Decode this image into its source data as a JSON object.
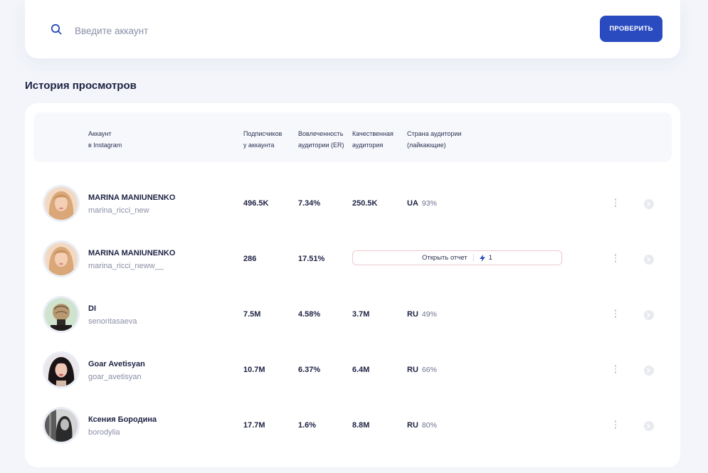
{
  "search": {
    "placeholder": "Введите аккаунт",
    "button_label": "ПРОВЕРИТЬ"
  },
  "history": {
    "title": "История просмотров",
    "columns": {
      "account": [
        "Аккаунт",
        "в Instagram"
      ],
      "followers": [
        "Подписчиков",
        "у аккаунта"
      ],
      "engagement": [
        "Вовлеченность",
        "аудитории (ER)"
      ],
      "quality": [
        "Качественная",
        "аудитория"
      ],
      "country": [
        "Страна аудитории",
        "(лайкающие)"
      ]
    },
    "report": {
      "label": "Открыть отчет",
      "count": "1"
    },
    "rows": [
      {
        "name": "MARINA MANIUNENKO",
        "handle": "marina_ricci_new",
        "followers": "496.5K",
        "er": "7.34%",
        "quality": "250.5K",
        "country": "UA",
        "country_pct": "93%",
        "avatar": "blonde-woman-avatar"
      },
      {
        "name": "MARINA MANIUNENKO",
        "handle": "marina_ricci_neww__",
        "followers": "286",
        "er": "17.51%",
        "quality": "",
        "country": "",
        "country_pct": "",
        "avatar": "blonde-woman-avatar",
        "report": true
      },
      {
        "name": "DI",
        "handle": "senoritasaeva",
        "followers": "7.5M",
        "er": "4.58%",
        "quality": "3.7M",
        "country": "RU",
        "country_pct": "49%",
        "avatar": "hair-bun-avatar"
      },
      {
        "name": "Goar Avetisyan",
        "handle": "goar_avetisyan",
        "followers": "10.7M",
        "er": "6.37%",
        "quality": "6.4M",
        "country": "RU",
        "country_pct": "66%",
        "avatar": "dark-hair-woman-avatar"
      },
      {
        "name": "Ксения Бородина",
        "handle": "borodylia",
        "followers": "17.7M",
        "er": "1.6%",
        "quality": "8.8M",
        "country": "RU",
        "country_pct": "80%",
        "avatar": "monochrome-avatar"
      }
    ]
  },
  "colors": {
    "accent": "#2a4bbf",
    "page_bg": "#f3f5fa",
    "text": "#1d2243",
    "muted": "#8a8fa6"
  }
}
